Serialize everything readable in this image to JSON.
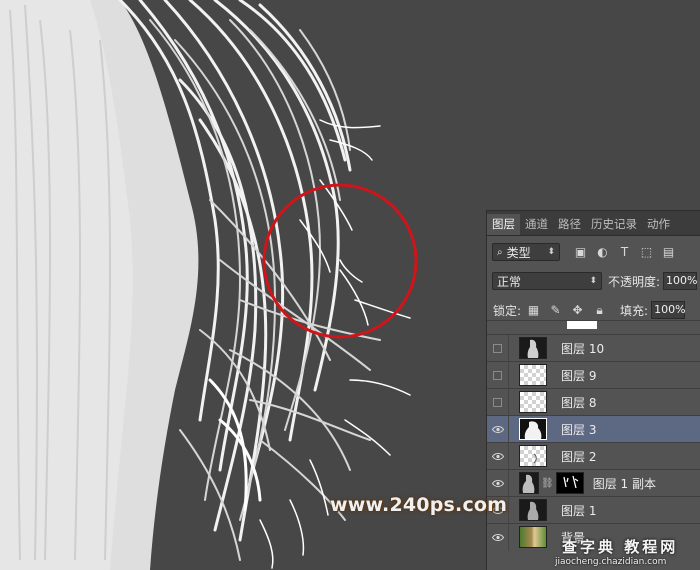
{
  "panel": {
    "tabs": [
      {
        "label": "图层",
        "active": true
      },
      {
        "label": "通道"
      },
      {
        "label": "路径"
      },
      {
        "label": "历史记录"
      },
      {
        "label": "动作"
      }
    ],
    "filter_kind": "类型",
    "blend_mode": "正常",
    "opacity_label": "不透明度:",
    "opacity_value": "100%",
    "lock_label": "锁定:",
    "fill_label": "填充:",
    "fill_value": "100%",
    "layers": [
      {
        "name": "图层 10",
        "visible": false,
        "thumb": "dark"
      },
      {
        "name": "图层 9",
        "visible": false,
        "thumb": "checker"
      },
      {
        "name": "图层 8",
        "visible": false,
        "thumb": "checker"
      },
      {
        "name": "图层 3",
        "visible": true,
        "selected": true,
        "thumb": "mask"
      },
      {
        "name": "图层 2",
        "visible": true,
        "thumb": "checker"
      },
      {
        "name": "图层 1 副本",
        "visible": true,
        "thumb": "dark",
        "has_mask": true
      },
      {
        "name": "图层 1",
        "visible": true,
        "thumb": "dark"
      },
      {
        "name": "背景",
        "visible": true,
        "thumb": "photo"
      }
    ]
  },
  "watermark": {
    "site": "www.240ps.com",
    "brand": "查字典 教程网",
    "url": "jiaocheng.chazidian.com"
  },
  "colors": {
    "canvas_bg": "#474747",
    "highlight_circle": "#d0141a",
    "panel_bg": "#535353",
    "selected_row": "#5d6883"
  }
}
